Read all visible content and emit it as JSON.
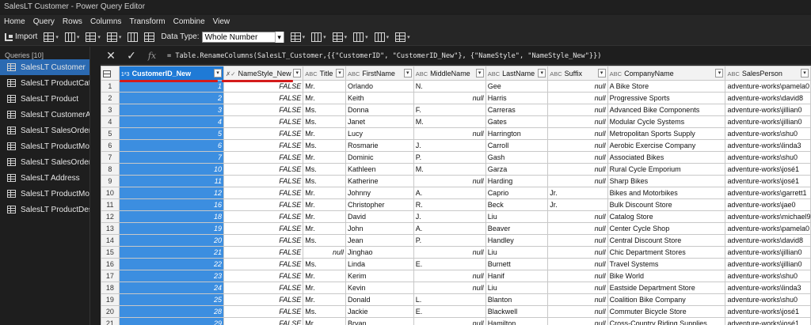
{
  "window": {
    "title": "SalesLT Customer - Power Query Editor"
  },
  "menu": [
    "Home",
    "Query",
    "Rows",
    "Columns",
    "Transform",
    "Combine",
    "View"
  ],
  "toolbar": {
    "import_label": "Import",
    "datatype_label": "Data Type:",
    "datatype_value": "Whole Number"
  },
  "queries": {
    "header": "Queries [10]",
    "items": [
      "SalesLT Customer",
      "SalesLT ProductCate...",
      "SalesLT Product",
      "SalesLT CustomerAd...",
      "SalesLT SalesOrderH...",
      "SalesLT ProductModel",
      "SalesLT SalesOrderD...",
      "SalesLT Address",
      "SalesLT ProductMod...",
      "SalesLT ProductDescr..."
    ]
  },
  "formula": "= Table.RenameColumns(SalesLT_Customer,{{\"CustomerID\", \"CustomerID_New\"}, {\"NameStyle\", \"NameStyle_New\"}})",
  "grid": {
    "columns": [
      {
        "name": "CustomerID_New",
        "type": "1²3"
      },
      {
        "name": "NameStyle_New",
        "type": "✗✓"
      },
      {
        "name": "Title",
        "type": "ABC"
      },
      {
        "name": "FirstName",
        "type": "ABC"
      },
      {
        "name": "MiddleName",
        "type": "ABC"
      },
      {
        "name": "LastName",
        "type": "ABC"
      },
      {
        "name": "Suffix",
        "type": "ABC"
      },
      {
        "name": "CompanyName",
        "type": "ABC"
      },
      {
        "name": "SalesPerson",
        "type": "ABC"
      }
    ],
    "rows": [
      [
        "1",
        "1",
        "FALSE",
        "Mr.",
        "Orlando",
        "N.",
        "Gee",
        "null",
        "A Bike Store",
        "adventure-works\\pamela0"
      ],
      [
        "2",
        "2",
        "FALSE",
        "Mr.",
        "Keith",
        "null",
        "Harris",
        "null",
        "Progressive Sports",
        "adventure-works\\david8"
      ],
      [
        "3",
        "3",
        "FALSE",
        "Ms.",
        "Donna",
        "F.",
        "Carreras",
        "null",
        "Advanced Bike Components",
        "adventure-works\\jillian0"
      ],
      [
        "4",
        "4",
        "FALSE",
        "Ms.",
        "Janet",
        "M.",
        "Gates",
        "null",
        "Modular Cycle Systems",
        "adventure-works\\jillian0"
      ],
      [
        "5",
        "5",
        "FALSE",
        "Mr.",
        "Lucy",
        "null",
        "Harrington",
        "null",
        "Metropolitan Sports Supply",
        "adventure-works\\shu0"
      ],
      [
        "6",
        "6",
        "FALSE",
        "Ms.",
        "Rosmarie",
        "J.",
        "Carroll",
        "null",
        "Aerobic Exercise Company",
        "adventure-works\\linda3"
      ],
      [
        "7",
        "7",
        "FALSE",
        "Mr.",
        "Dominic",
        "P.",
        "Gash",
        "null",
        "Associated Bikes",
        "adventure-works\\shu0"
      ],
      [
        "8",
        "10",
        "FALSE",
        "Ms.",
        "Kathleen",
        "M.",
        "Garza",
        "null",
        "Rural Cycle Emporium",
        "adventure-works\\josé1"
      ],
      [
        "9",
        "11",
        "FALSE",
        "Ms.",
        "Katherine",
        "null",
        "Harding",
        "null",
        "Sharp Bikes",
        "adventure-works\\josé1"
      ],
      [
        "10",
        "12",
        "FALSE",
        "Mr.",
        "Johnny",
        "A.",
        "Caprio",
        "Jr.",
        "Bikes and Motorbikes",
        "adventure-works\\garrett1"
      ],
      [
        "11",
        "16",
        "FALSE",
        "Mr.",
        "Christopher",
        "R.",
        "Beck",
        "Jr.",
        "Bulk Discount Store",
        "adventure-works\\jae0"
      ],
      [
        "12",
        "18",
        "FALSE",
        "Mr.",
        "David",
        "J.",
        "Liu",
        "null",
        "Catalog Store",
        "adventure-works\\michael9"
      ],
      [
        "13",
        "19",
        "FALSE",
        "Mr.",
        "John",
        "A.",
        "Beaver",
        "null",
        "Center Cycle Shop",
        "adventure-works\\pamela0"
      ],
      [
        "14",
        "20",
        "FALSE",
        "Ms.",
        "Jean",
        "P.",
        "Handley",
        "null",
        "Central Discount Store",
        "adventure-works\\david8"
      ],
      [
        "15",
        "21",
        "FALSE",
        "null",
        "Jinghao",
        "null",
        "Liu",
        "null",
        "Chic Department Stores",
        "adventure-works\\jillian0"
      ],
      [
        "16",
        "22",
        "FALSE",
        "Ms.",
        "Linda",
        "E.",
        "Burnett",
        "null",
        "Travel Systems",
        "adventure-works\\jillian0"
      ],
      [
        "17",
        "23",
        "FALSE",
        "Mr.",
        "Kerim",
        "null",
        "Hanif",
        "null",
        "Bike World",
        "adventure-works\\shu0"
      ],
      [
        "18",
        "24",
        "FALSE",
        "Mr.",
        "Kevin",
        "null",
        "Liu",
        "null",
        "Eastside Department Store",
        "adventure-works\\linda3"
      ],
      [
        "19",
        "25",
        "FALSE",
        "Mr.",
        "Donald",
        "L.",
        "Blanton",
        "null",
        "Coalition Bike Company",
        "adventure-works\\shu0"
      ],
      [
        "20",
        "28",
        "FALSE",
        "Ms.",
        "Jackie",
        "E.",
        "Blackwell",
        "null",
        "Commuter Bicycle Store",
        "adventure-works\\josé1"
      ],
      [
        "21",
        "29",
        "FALSE",
        "Mr.",
        "Bryan",
        "null",
        "Hamilton",
        "null",
        "Cross-Country Riding Supplies",
        "adventure-works\\josé1"
      ]
    ]
  },
  "colors": {
    "accent": "#2b6ab2",
    "selected_column": "#3c8ee0",
    "annotation": "#d41b1b"
  }
}
